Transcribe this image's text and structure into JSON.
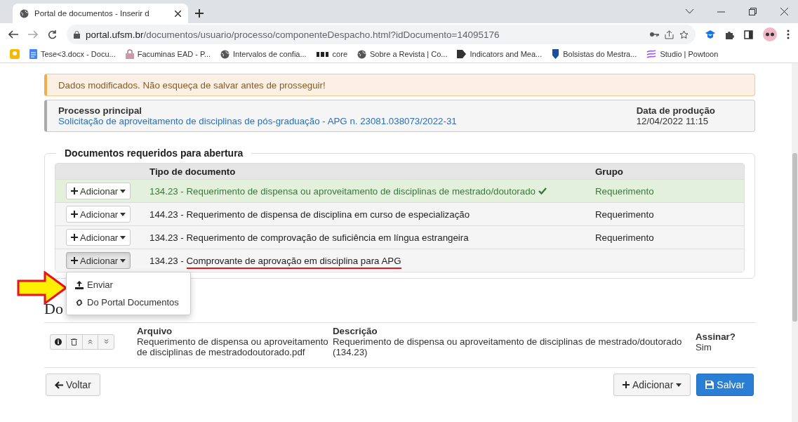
{
  "browser": {
    "tab_title": "Portal de documentos - Inserir d",
    "url_host": "portal.ufsm.br",
    "url_path": "/documentos/usuario/processo/componenteDespacho.html?idDocumento=14095176",
    "bookmarks": [
      {
        "kind": "bulb"
      },
      {
        "label": "Tese<3.docx - Docu...",
        "kind": "doc"
      },
      {
        "label": "Facuminas EAD - P...",
        "kind": "lock"
      },
      {
        "label": "Intervalos de confia...",
        "kind": "globe"
      },
      {
        "label": "core",
        "kind": "pkp"
      },
      {
        "label": "Sobre a Revista | Co...",
        "kind": "globe"
      },
      {
        "label": "Indicators and Mea...",
        "kind": "flag"
      },
      {
        "label": "Bolsistas do Mestra...",
        "kind": "ufsm"
      },
      {
        "label": "Studio | Powtoon",
        "kind": "swirl"
      }
    ]
  },
  "alert": "Dados modificados. Não esqueça de salvar antes de prosseguir!",
  "process": {
    "label": "Processo principal",
    "link": "Solicitação de aproveitamento de disciplinas de pós-graduação - APG n. 23081.038073/2022-31",
    "date_label": "Data de produção",
    "date": "12/04/2022 11:15"
  },
  "required": {
    "legend": "Documentos requeridos para abertura",
    "columns": [
      "Tipo de documento",
      "Grupo"
    ],
    "rows": [
      {
        "button": "Adicionar",
        "code": "134.23 -",
        "type": "Requerimento de dispensa ou aproveitamento de disciplinas de mestrado/doutorado",
        "group": "Requerimento",
        "done": true,
        "menu_open": false
      },
      {
        "button": "Adicionar",
        "code": "144.23 -",
        "type": "Requerimento de dispensa de disciplina em curso de especialização",
        "group": "Requerimento",
        "done": false,
        "menu_open": false
      },
      {
        "button": "Adicionar",
        "code": "134.23 -",
        "type": "Requerimento de comprovação de suficiência em língua estrangeira",
        "group": "Requerimento",
        "done": false,
        "menu_open": false
      },
      {
        "button": "Adicionar",
        "code": "134.23 -",
        "type": "Comprovante de aprovação em disciplina para APG",
        "group": "",
        "done": false,
        "menu_open": true
      }
    ]
  },
  "menu": [
    {
      "label": "Enviar",
      "kind": "upload"
    },
    {
      "label": "Do Portal Documentos",
      "kind": "link"
    }
  ],
  "documents_heading": "Do",
  "attachments": [
    {
      "file_label": "Arquivo",
      "file": "Requerimento de dispensa ou aproveitamento de disciplinas de mestradodoutorado.pdf",
      "desc_label": "Descrição",
      "desc": "Requerimento de dispensa ou aproveitamento de disciplinas de mestrado/doutorado (134.23)",
      "sign_label": "Assinar?",
      "sign": "Sim"
    }
  ],
  "footer": {
    "back": "Voltar",
    "add": "Adicionar",
    "save": "Salvar"
  }
}
